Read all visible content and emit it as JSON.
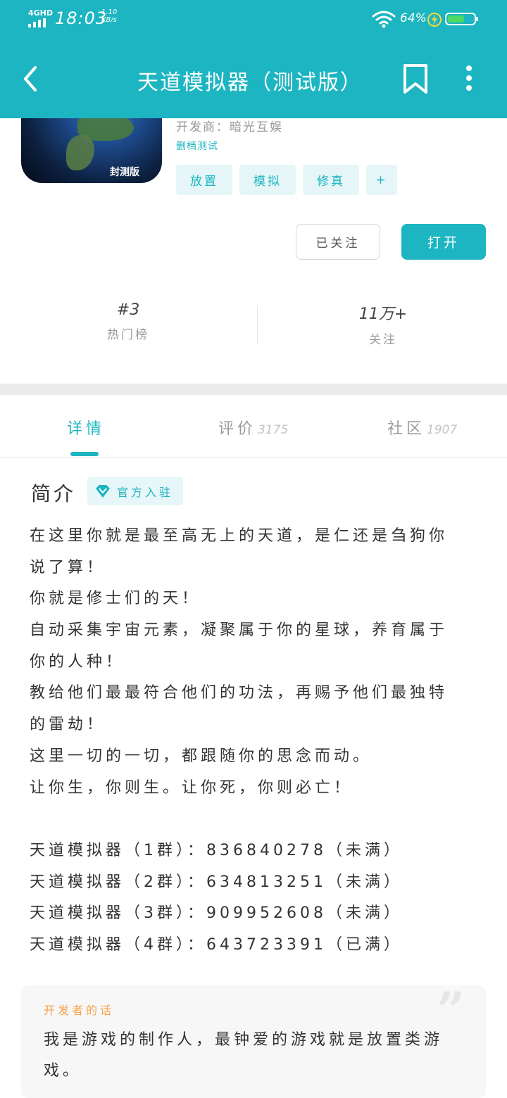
{
  "status_bar": {
    "network": "4GHD",
    "time": "18:03",
    "speed_value": "1.10",
    "speed_unit": "KB/s",
    "battery_percent": "64%",
    "battery_level": 0.64
  },
  "toolbar": {
    "title": "天道模拟器（测试版）"
  },
  "app": {
    "developer": "开发商：暗光互娱",
    "test_label": "删档测试",
    "icon_badge": "封测版",
    "tags": [
      "放置",
      "模拟",
      "修真",
      "+"
    ],
    "follow_button": "已关注",
    "open_button": "打开"
  },
  "stats": {
    "rank_value": "#3",
    "rank_label": "热门榜",
    "followers_value": "11万+",
    "followers_label": "关注"
  },
  "tabs": [
    {
      "label": "详情",
      "count": ""
    },
    {
      "label": "评价",
      "count": "3175"
    },
    {
      "label": "社区",
      "count": "1907"
    }
  ],
  "intro": {
    "title": "简介",
    "official_badge": "官方入驻",
    "lines": [
      "在这里你就是最至高无上的天道，是仁还是刍狗你",
      "说了算！",
      "你就是修士们的天！",
      "自动采集宇宙元素，凝聚属于你的星球，养育属于",
      "你的人种！",
      "教给他们最最符合他们的功法，再赐予他们最独特",
      "的雷劫！",
      "这里一切的一切，都跟随你的思念而动。",
      "让你生，你则生。让你死，你则必亡！",
      "",
      "天道模拟器（1群）：836840278（未满）",
      "天道模拟器（2群）：634813251（未满）",
      "天道模拟器（3群）：909952608（未满）",
      "天道模拟器（4群）：643723391（已满）"
    ]
  },
  "developer_note": {
    "heading": "开发者的话",
    "text": "我是游戏的制作人，最钟爱的游戏就是放置类游戏。"
  },
  "colors": {
    "accent": "#1cb5c1",
    "note_heading": "#f5a34a",
    "battery_fill": "#4cd964"
  }
}
